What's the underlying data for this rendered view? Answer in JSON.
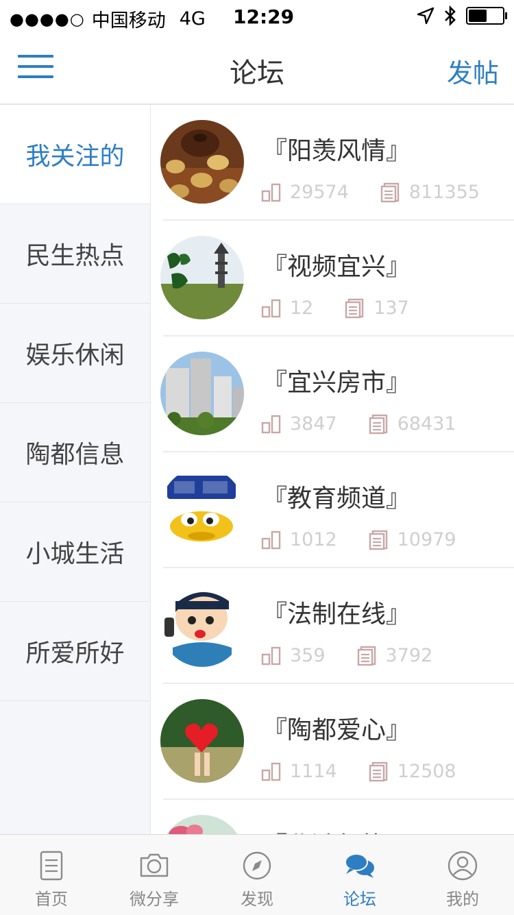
{
  "status_bar": {
    "signal": "●●●●○",
    "carrier": "中国移动",
    "network": "4G",
    "time": "12:29"
  },
  "navbar": {
    "title": "论坛",
    "post_label": "发帖"
  },
  "sidebar": {
    "items": [
      {
        "label": "我关注的",
        "active": true
      },
      {
        "label": "民生热点"
      },
      {
        "label": "娱乐休闲"
      },
      {
        "label": "陶都信息"
      },
      {
        "label": "小城生活"
      },
      {
        "label": "所爱所好"
      }
    ]
  },
  "forums": [
    {
      "name": "『阳羡风情』",
      "stat1": "29574",
      "stat2": "811355"
    },
    {
      "name": "『视频宜兴』",
      "stat1": "12",
      "stat2": "137"
    },
    {
      "name": "『宜兴房市』",
      "stat1": "3847",
      "stat2": "68431"
    },
    {
      "name": "『教育频道』",
      "stat1": "1012",
      "stat2": "10979"
    },
    {
      "name": "『法制在线』",
      "stat1": "359",
      "stat2": "3792"
    },
    {
      "name": "『陶都爱心』",
      "stat1": "1114",
      "stat2": "12508"
    },
    {
      "name": "『北滩氛栈』",
      "stat1": "",
      "stat2": ""
    }
  ],
  "tabbar": {
    "items": [
      {
        "label": "首页",
        "icon": "document-icon"
      },
      {
        "label": "微分享",
        "icon": "camera-icon"
      },
      {
        "label": "发现",
        "icon": "compass-icon"
      },
      {
        "label": "论坛",
        "icon": "chat-bubble-icon",
        "active": true
      },
      {
        "label": "我的",
        "icon": "user-icon"
      }
    ]
  },
  "colors": {
    "accent": "#2d7ec3",
    "stat_icon": "#c9a6a6",
    "stat_text": "#cfcfcf",
    "sidebar_bg": "#f5f6fa"
  }
}
